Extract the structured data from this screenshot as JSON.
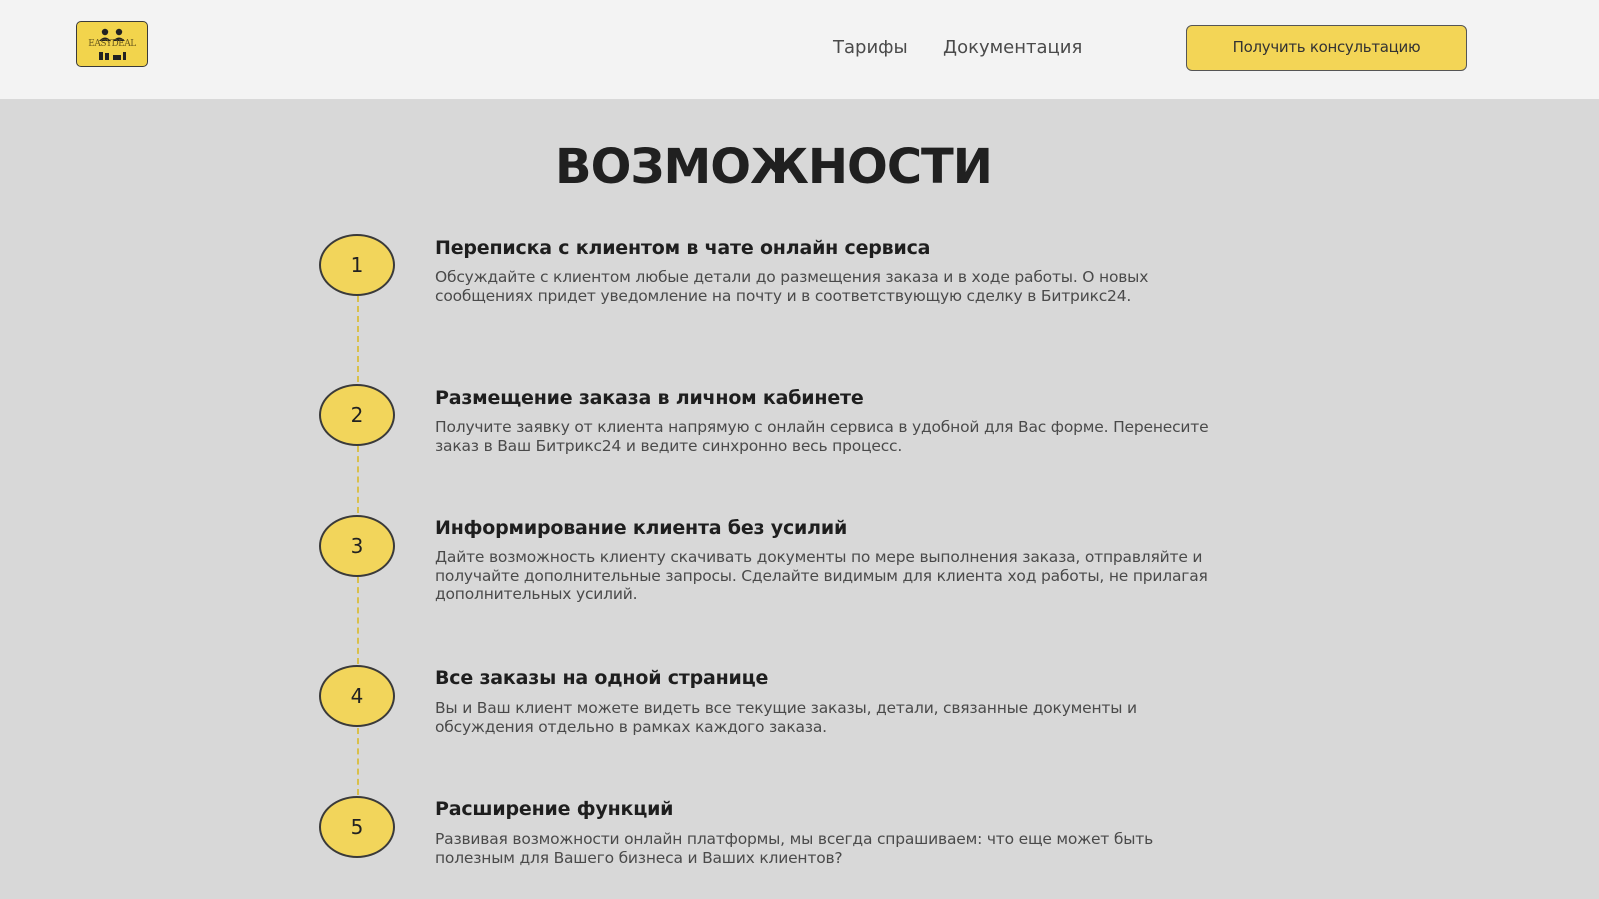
{
  "header": {
    "logo_text": "EASYDEAL",
    "nav": [
      {
        "label": "Тарифы"
      },
      {
        "label": "Документация"
      }
    ],
    "cta_label": "Получить консультацию"
  },
  "section": {
    "title": "ВОЗМОЖНОСТИ",
    "steps": [
      {
        "number": "1",
        "title": "Переписка с клиентом в чате онлайн сервиса",
        "description": "Обсуждайте с клиентом любые детали до размещения заказа и в ходе работы. О новых сообщениях придет уведомление на почту и в соответствующую сделку в Битрикс24."
      },
      {
        "number": "2",
        "title": "Размещение заказа в личном кабинете",
        "description": "Получите заявку от клиента напрямую с онлайн сервиса в удобной для Вас форме. Перенесите заказ в Ваш Битрикс24 и ведите синхронно весь процесс."
      },
      {
        "number": "3",
        "title": "Информирование клиента без усилий",
        "description": "Дайте возможность клиенту скачивать документы по мере выполнения заказа, отправляйте и получайте дополнительные запросы. Сделайте видимым для клиента ход работы, не прилагая дополнительных усилий."
      },
      {
        "number": "4",
        "title": "Все заказы на одной странице",
        "description": "Вы и Ваш клиент можете видеть все текущие заказы, детали, связанные документы и  обсуждения отдельно в рамках каждого заказа."
      },
      {
        "number": "5",
        "title": "Расширение функций",
        "description": "Развивая возможности онлайн платформы, мы всегда спрашиваем: что еще может быть полезным для Вашего бизнеса и Ваших клиентов?"
      }
    ]
  },
  "colors": {
    "accent": "#f2d55b",
    "header_bg": "#f3f3f3",
    "page_bg": "#d8d8d8"
  }
}
